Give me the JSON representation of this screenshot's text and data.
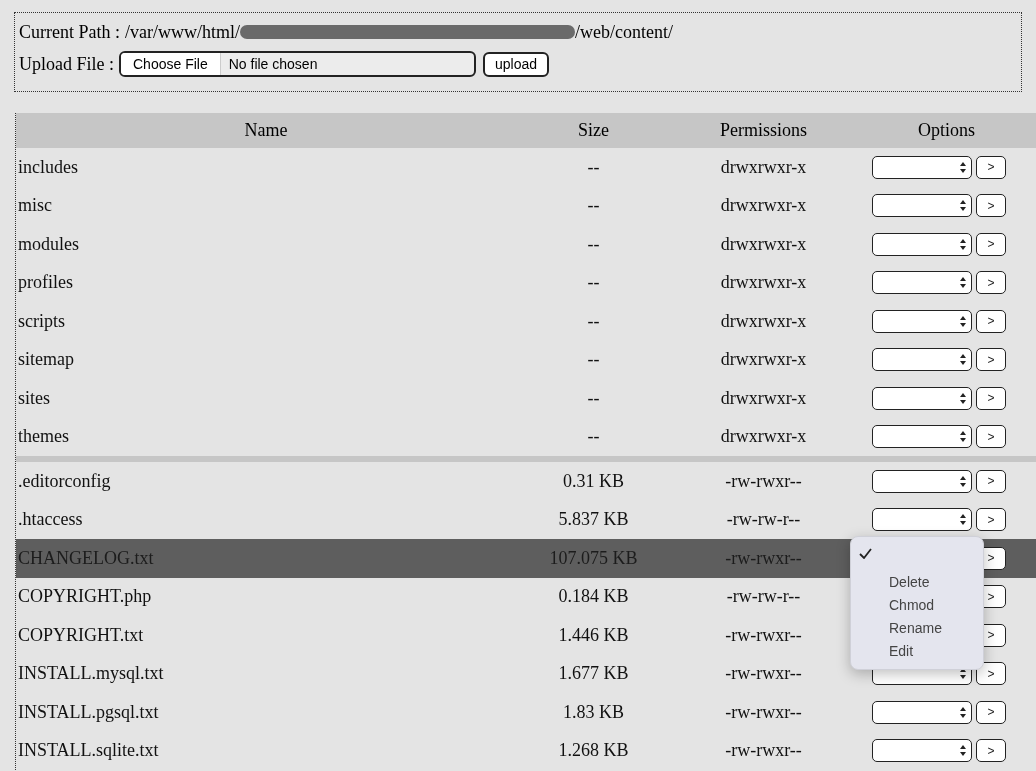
{
  "header": {
    "path_label": "Current Path :",
    "path_start": "/var/www/html/",
    "path_redacted": true,
    "path_end": "/web/content/",
    "upload_label": "Upload File :",
    "choose_button": "Choose File",
    "file_status": "No file chosen",
    "upload_button": "upload"
  },
  "table": {
    "columns": [
      "Name",
      "Size",
      "Permissions",
      "Options"
    ],
    "groups": [
      {
        "rows": [
          {
            "name": "includes",
            "size": "--",
            "permissions": "drwxrwxr-x",
            "action": ">",
            "selected": false
          },
          {
            "name": "misc",
            "size": "--",
            "permissions": "drwxrwxr-x",
            "action": ">",
            "selected": false
          },
          {
            "name": "modules",
            "size": "--",
            "permissions": "drwxrwxr-x",
            "action": ">",
            "selected": false
          },
          {
            "name": "profiles",
            "size": "--",
            "permissions": "drwxrwxr-x",
            "action": ">",
            "selected": false
          },
          {
            "name": "scripts",
            "size": "--",
            "permissions": "drwxrwxr-x",
            "action": ">",
            "selected": false
          },
          {
            "name": "sitemap",
            "size": "--",
            "permissions": "drwxrwxr-x",
            "action": ">",
            "selected": false
          },
          {
            "name": "sites",
            "size": "--",
            "permissions": "drwxrwxr-x",
            "action": ">",
            "selected": false
          },
          {
            "name": "themes",
            "size": "--",
            "permissions": "drwxrwxr-x",
            "action": ">",
            "selected": false
          }
        ]
      },
      {
        "rows": [
          {
            "name": ".editorconfig",
            "size": "0.31 KB",
            "permissions": "-rw-rwxr--",
            "action": ">",
            "selected": false
          },
          {
            "name": ".htaccess",
            "size": "5.837 KB",
            "permissions": "-rw-rw-r--",
            "action": ">",
            "selected": false
          },
          {
            "name": "CHANGELOG.txt",
            "size": "107.075 KB",
            "permissions": "-rw-rwxr--",
            "action": ">",
            "selected": true
          },
          {
            "name": "COPYRIGHT.php",
            "size": "0.184 KB",
            "permissions": "-rw-rw-r--",
            "action": ">",
            "selected": false
          },
          {
            "name": "COPYRIGHT.txt",
            "size": "1.446 KB",
            "permissions": "-rw-rwxr--",
            "action": ">",
            "selected": false
          },
          {
            "name": "INSTALL.mysql.txt",
            "size": "1.677 KB",
            "permissions": "-rw-rwxr--",
            "action": ">",
            "selected": false
          },
          {
            "name": "INSTALL.pgsql.txt",
            "size": "1.83 KB",
            "permissions": "-rw-rwxr--",
            "action": ">",
            "selected": false
          },
          {
            "name": "INSTALL.sqlite.txt",
            "size": "1.268 KB",
            "permissions": "-rw-rwxr--",
            "action": ">",
            "selected": false
          }
        ]
      }
    ]
  },
  "options_menu": {
    "blank_option_checked": true,
    "items": [
      {
        "label": "Delete"
      },
      {
        "label": "Chmod"
      },
      {
        "label": "Rename"
      },
      {
        "label": "Edit"
      }
    ]
  }
}
